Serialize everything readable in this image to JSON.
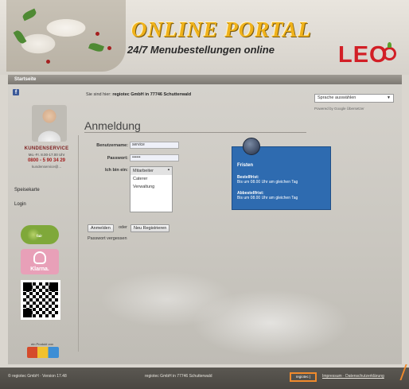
{
  "header": {
    "title": "ONLINE PORTAL",
    "subtitle": "24/7 Menubestellungen online",
    "logo": "LEO"
  },
  "nav": {
    "start": "Startseite"
  },
  "sidebar": {
    "facebook": "f",
    "kundenservice": "KUNDENSERVICE",
    "hours": "Mo.-Fr. 8.00-17.00 Uhr",
    "phone": "0800 - 5 90 34 29",
    "email": "kundenservice@...",
    "links": [
      "Speisekarte",
      "Login"
    ],
    "fair_badge": "fair",
    "klarna": "Klarna.",
    "partner_label": "ein Produkt von",
    "partner_logo": "regiotec"
  },
  "content": {
    "info_prefix": "Sie sind hier:",
    "info_company": "regiotec GmbH in 77746 Schutterwald",
    "language_select": "Sprache auswählen",
    "powered_by": "Powered by Google Übersetzer",
    "heading": "Anmeldung",
    "form": {
      "username_label": "Benutzername:",
      "username_value": "service",
      "password_label": "Passwort:",
      "password_value": "••••••",
      "role_label": "Ich bin ein:",
      "roles": [
        "Mitarbeiter",
        "Caterer",
        "Verwaltung"
      ],
      "selected_role": "Mitarbeiter"
    },
    "login_button": "Anmelden",
    "oder": "oder",
    "register_button": "Neu Registrieren",
    "forgot_password": "Passwort vergessen",
    "fristen": {
      "title": "Fristen",
      "bestellfrist_label": "Bestellfrist:",
      "bestellfrist_text": "Bis um 08.00 Uhr am gleichen Tag",
      "abbestellfrist_label": "Abbestellfrist:",
      "abbestellfrist_text": "Bis um 08.00 Uhr am gleichen Tag"
    }
  },
  "footer": {
    "left": "© regiotec GmbH · Version 17.48",
    "center": "regiotec GmbH in 77746 Schutterwald",
    "regio_link": "regiotec | ",
    "impressum": "Impressum · Datenschutzerklärung"
  },
  "colors": {
    "accent": "#f0b21a",
    "brand_red": "#d21f26",
    "fristen_blue": "#2e6bb0",
    "highlight_orange": "#f08a2c"
  }
}
